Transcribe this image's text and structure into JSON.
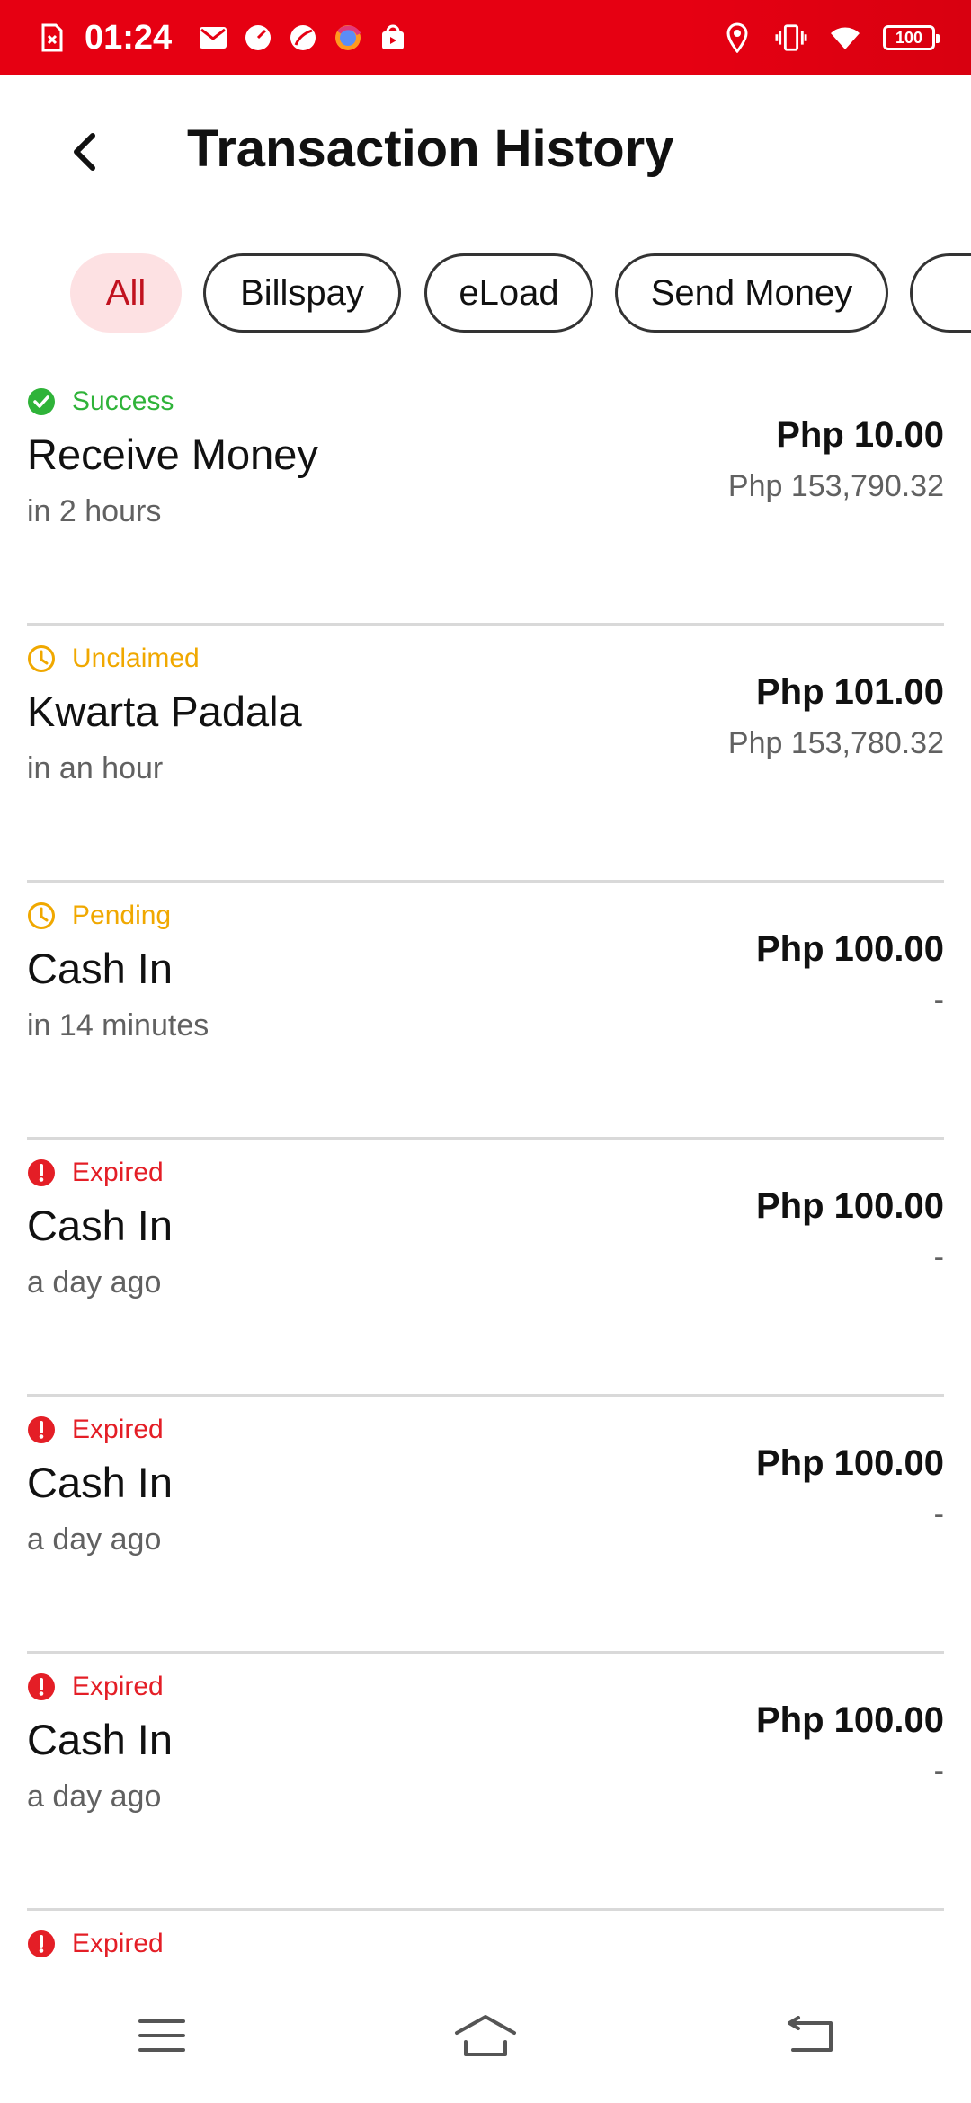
{
  "status_bar": {
    "time": "01:24",
    "battery": "100",
    "icons_left": [
      "sim-alert-icon",
      "mail-icon",
      "speedometer-icon",
      "leaf-icon",
      "browser-icon",
      "shop-icon"
    ],
    "icons_right": [
      "location-icon",
      "vibrate-icon",
      "wifi-icon",
      "battery-icon"
    ],
    "background": "#e60012"
  },
  "header": {
    "title": "Transaction History",
    "back_icon": "back-arrow-icon"
  },
  "filters": {
    "items": [
      "All",
      "Billspay",
      "eLoad",
      "Send Money",
      ""
    ],
    "selected": "All",
    "active_bg": "#fde1e3",
    "active_fg": "#c1121f"
  },
  "colors": {
    "success": "#2fb339",
    "warning": "#f0a800",
    "error": "#e41e26"
  },
  "transactions": [
    {
      "status": "Success",
      "status_type": "success",
      "title": "Receive Money",
      "time": "in 2 hours",
      "amount": "Php 10.00",
      "balance": "Php 153,790.32"
    },
    {
      "status": "Unclaimed",
      "status_type": "warning",
      "title": "Kwarta Padala",
      "time": "in an hour",
      "amount": "Php 101.00",
      "balance": "Php 153,780.32"
    },
    {
      "status": "Pending",
      "status_type": "warning",
      "title": "Cash In",
      "time": "in 14 minutes",
      "amount": "Php 100.00",
      "balance": "-"
    },
    {
      "status": "Expired",
      "status_type": "error",
      "title": "Cash In",
      "time": "a day ago",
      "amount": "Php 100.00",
      "balance": "-"
    },
    {
      "status": "Expired",
      "status_type": "error",
      "title": "Cash In",
      "time": "a day ago",
      "amount": "Php 100.00",
      "balance": "-"
    },
    {
      "status": "Expired",
      "status_type": "error",
      "title": "Cash In",
      "time": "a day ago",
      "amount": "Php 100.00",
      "balance": "-"
    },
    {
      "status": "Expired",
      "status_type": "error"
    }
  ],
  "nav": [
    "menu-icon",
    "home-icon",
    "return-icon"
  ]
}
